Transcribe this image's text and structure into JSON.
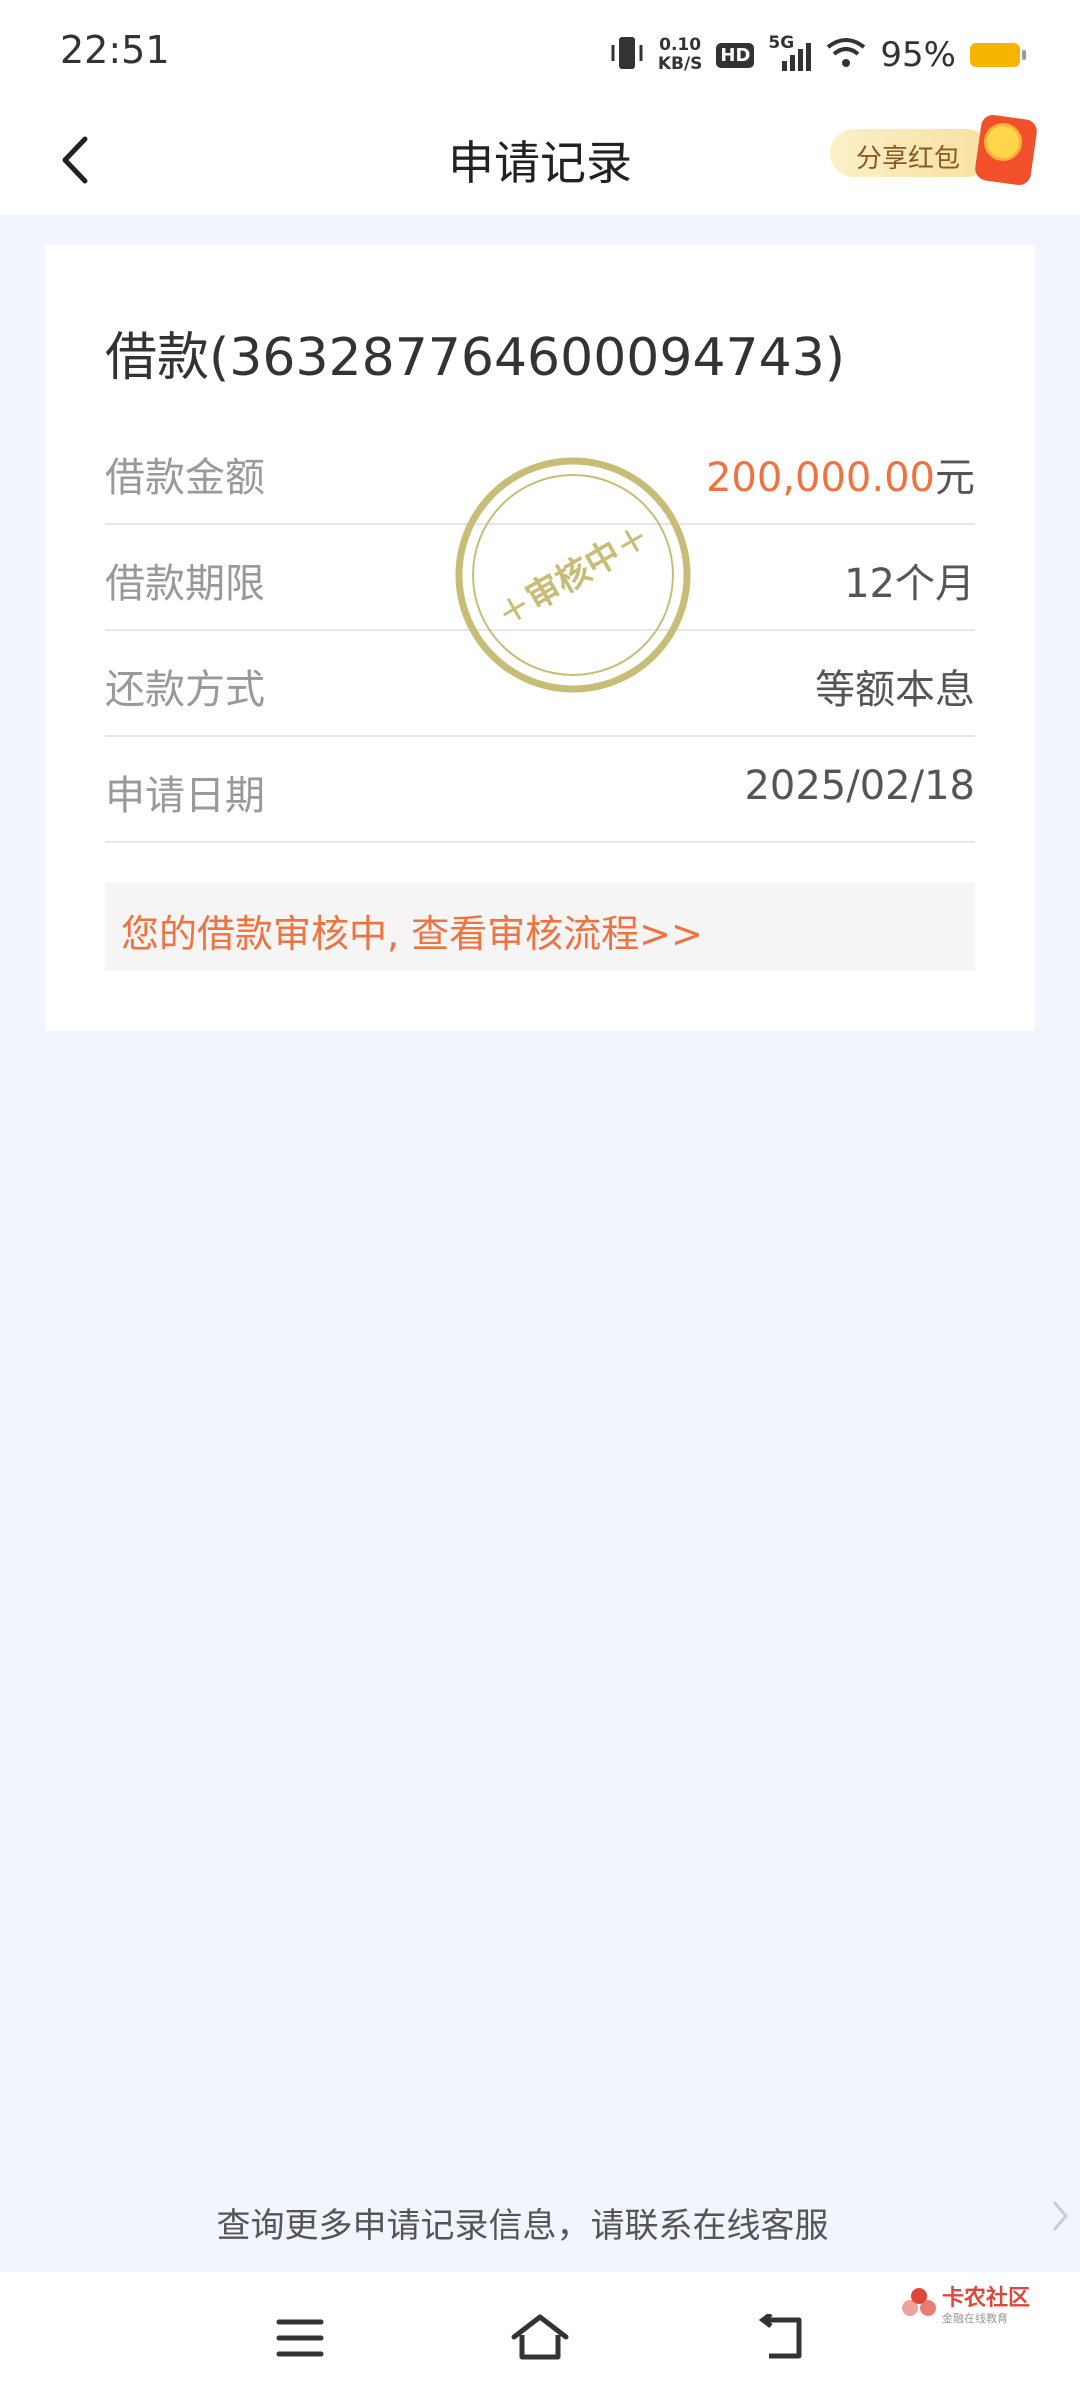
{
  "status_bar": {
    "time": "22:51",
    "net_speed_value": "0.10",
    "net_speed_unit": "KB/S",
    "hd_label": "HD",
    "network_label": "5G",
    "battery_percent": "95%",
    "battery_color": "#f7b500"
  },
  "nav": {
    "title": "申请记录",
    "share_label": "分享红包"
  },
  "card": {
    "loan_title": "借款(363287764600094743)",
    "rows": [
      {
        "label": "借款金额",
        "value": "200,000.00",
        "unit": "元"
      },
      {
        "label": "借款期限",
        "value": "12个月"
      },
      {
        "label": "还款方式",
        "value": "等额本息"
      },
      {
        "label": "申请日期",
        "value": "2025/02/18"
      }
    ],
    "stamp_text": "审核中",
    "notice": "您的借款审核中, 查看审核流程>>"
  },
  "footer": {
    "text": "查询更多申请记录信息，请联系在线客服"
  },
  "watermark": {
    "name": "卡农社区",
    "sub": "金融在线教育"
  },
  "colors": {
    "accent_orange": "#ee7340",
    "stamp_gold": "#c8bd77",
    "page_background": "#f1f5fd"
  },
  "icons": [
    "back-arrow-icon",
    "vibrate-icon",
    "signal-icon",
    "wifi-icon",
    "battery-icon",
    "red-envelope-icon",
    "menu-icon",
    "home-icon",
    "back-icon",
    "chevron-right-icon"
  ]
}
